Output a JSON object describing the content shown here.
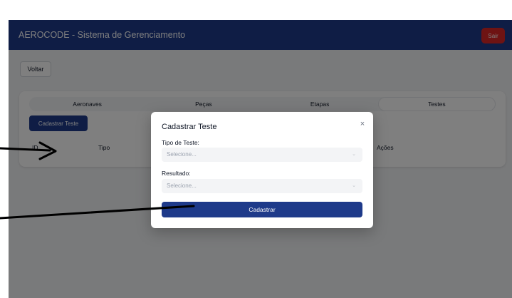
{
  "navbar": {
    "title": "AEROCODE - Sistema de Gerenciamento",
    "logout_label": "Sair"
  },
  "back_label": "Voltar",
  "tabs": [
    {
      "label": "Aeronaves",
      "active": false
    },
    {
      "label": "Peças",
      "active": false
    },
    {
      "label": "Etapas",
      "active": false
    },
    {
      "label": "Testes",
      "active": true
    }
  ],
  "add_test_label": "Cadastrar Teste",
  "table": {
    "columns": [
      "ID",
      "Tipo",
      "Ações"
    ]
  },
  "modal": {
    "title": "Cadastrar Teste",
    "close_glyph": "×",
    "test_type_label": "Tipo de Teste:",
    "test_type_value": "Selecione...",
    "result_label": "Resultado:",
    "result_value": "Selecione...",
    "submit_label": "Cadastrar"
  },
  "colors": {
    "primary": "#1e3a8a",
    "danger": "#dc2626",
    "background": "#f3f4f6"
  }
}
